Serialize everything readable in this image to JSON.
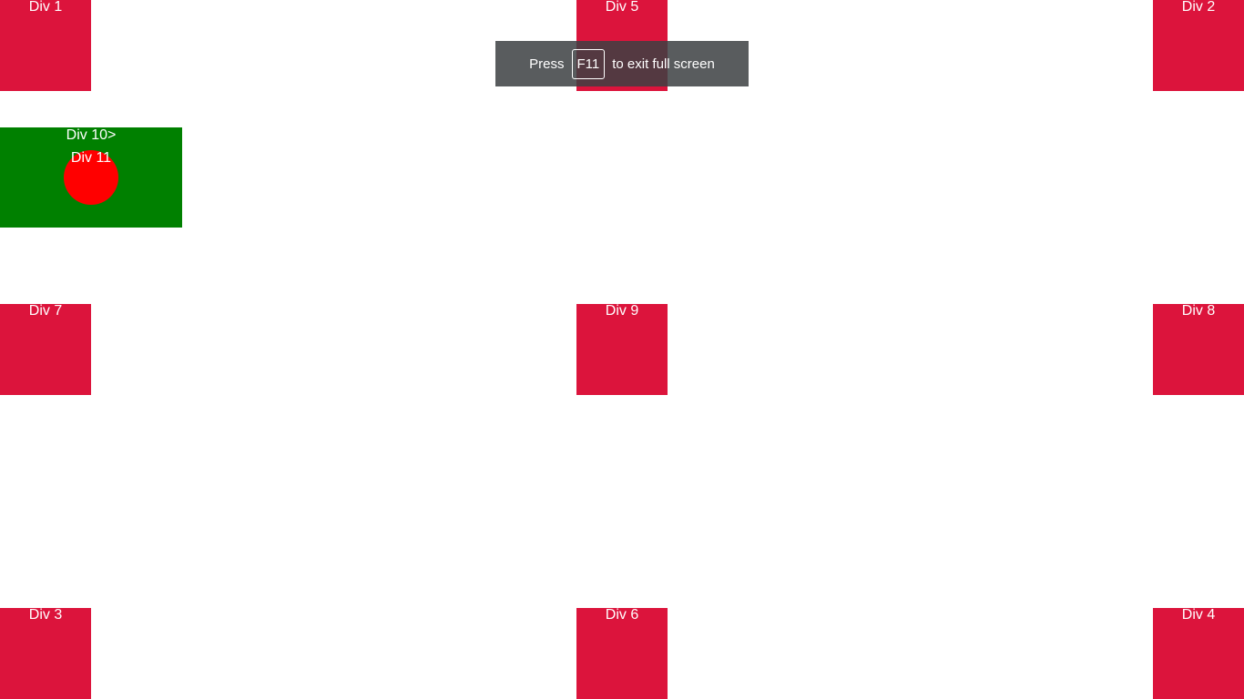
{
  "boxes": {
    "div1": "Div 1",
    "div2": "Div 2",
    "div3": "Div 3",
    "div4": "Div 4",
    "div5": "Div 5",
    "div6": "Div 6",
    "div7": "Div 7",
    "div8": "Div 8",
    "div9": "Div 9"
  },
  "flag": {
    "div10": "Div 10>",
    "div11": "Div 11"
  },
  "toast": {
    "prefix": "Press",
    "key": "F11",
    "suffix": "to exit full screen"
  },
  "colors": {
    "box": "#dc143c",
    "flag_bg": "#008000",
    "flag_circle": "#ff0000"
  }
}
